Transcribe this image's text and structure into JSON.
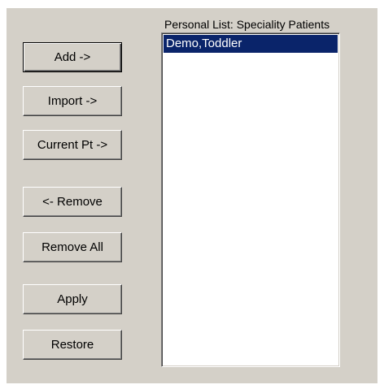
{
  "buttons": {
    "add": "Add ->",
    "import": "Import ->",
    "current_pt": "Current Pt ->",
    "remove": "<- Remove",
    "remove_all": "Remove All",
    "apply": "Apply",
    "restore": "Restore"
  },
  "list": {
    "label": "Personal List: Speciality Patients",
    "items": [
      {
        "label": "Demo,Toddler",
        "selected": true
      }
    ]
  },
  "colors": {
    "face": "#d4d0c8",
    "selection": "#0a246a"
  }
}
